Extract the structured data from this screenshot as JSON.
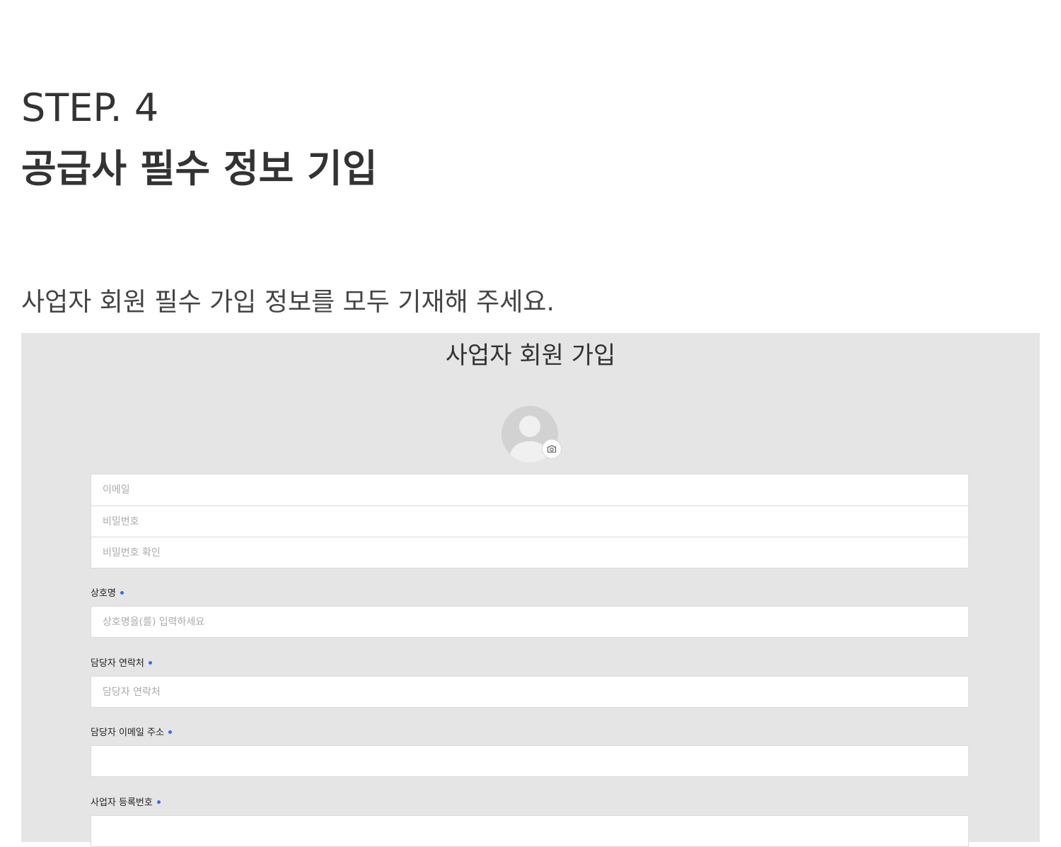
{
  "header": {
    "step": "STEP. 4",
    "title": "공급사 필수 정보 기입",
    "description": "사업자 회원 필수 가입 정보를 모두 기재해 주세요."
  },
  "form": {
    "title": "사업자 회원 가입",
    "avatar_icon": "user-avatar-placeholder",
    "camera_icon": "camera-icon",
    "accent_color": "#2f6bff",
    "credentials": {
      "email_placeholder": "이메일",
      "password_placeholder": "비밀번호",
      "password_confirm_placeholder": "비밀번호 확인"
    },
    "company_name": {
      "label": "상호명",
      "placeholder": "상호명을(를) 입력하세요"
    },
    "contact_phone": {
      "label": "담당자 연락처",
      "placeholder": "담당자 연락처"
    },
    "contact_email": {
      "label": "담당자 이메일 주소",
      "placeholder": ""
    },
    "business_number": {
      "label": "사업자 등록번호"
    }
  }
}
